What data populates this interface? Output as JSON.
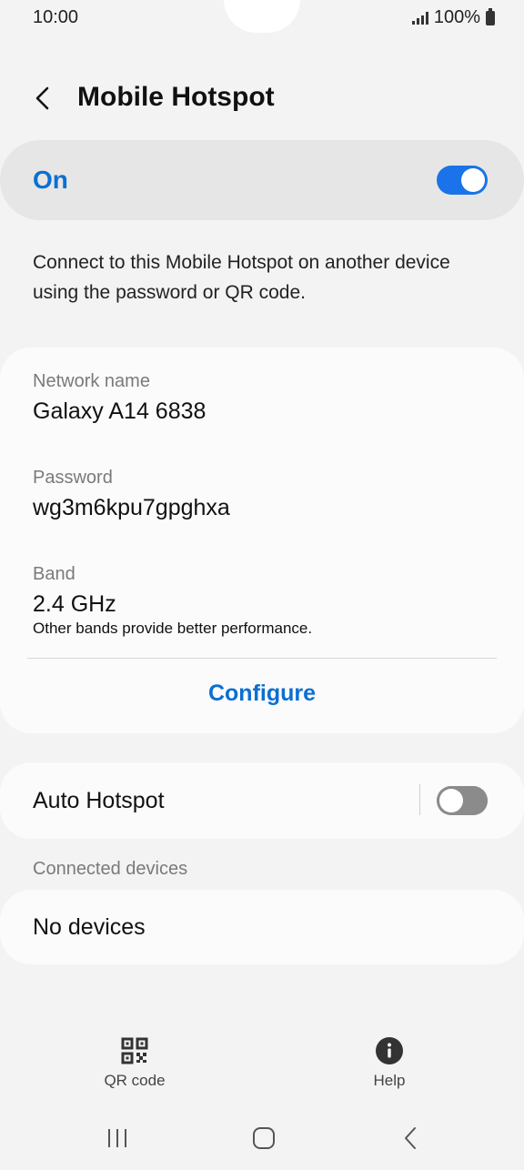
{
  "status": {
    "time": "10:00",
    "battery": "100%"
  },
  "header": {
    "title": "Mobile Hotspot"
  },
  "master": {
    "label": "On",
    "enabled": true
  },
  "description": "Connect to this Mobile Hotspot on another device using the password or QR code.",
  "network": {
    "name_label": "Network name",
    "name_value": "Galaxy A14 6838",
    "password_label": "Password",
    "password_value": "wg3m6kpu7gpghxa",
    "band_label": "Band",
    "band_value": "2.4 GHz",
    "band_note": "Other bands provide better performance.",
    "configure_label": "Configure"
  },
  "auto_hotspot": {
    "label": "Auto Hotspot",
    "enabled": false
  },
  "connected": {
    "section_label": "Connected devices",
    "empty_label": "No devices"
  },
  "bottom_actions": {
    "qr_label": "QR code",
    "help_label": "Help"
  },
  "colors": {
    "accent": "#0b6fd3",
    "switch_on": "#1a73e8",
    "background": "#f3f3f3"
  },
  "icons": {
    "back": "chevron-left-icon",
    "qr": "qr-code-icon",
    "help": "info-icon",
    "recents": "recents-icon",
    "home": "home-icon",
    "nav_back": "nav-back-icon"
  }
}
